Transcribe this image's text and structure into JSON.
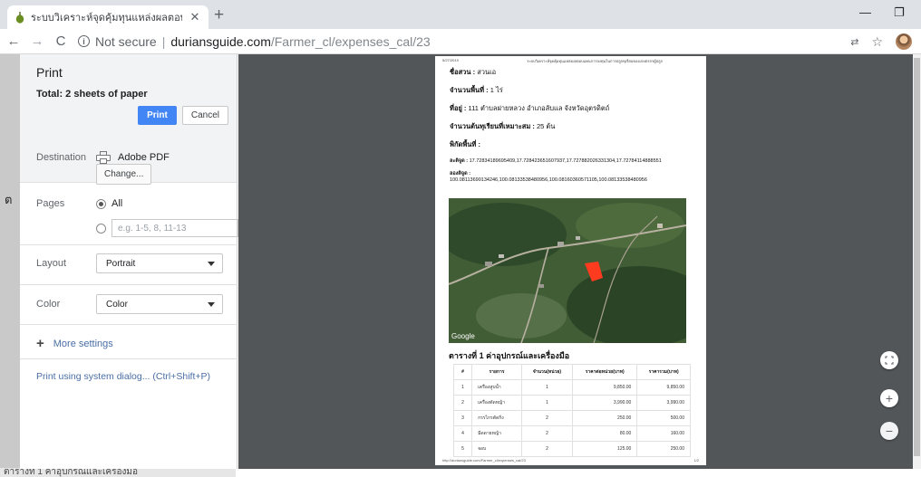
{
  "browser": {
    "tab_title": "ระบบวิเคราะห์จุดคุ้มทุนแหล่งผลตอบแทน",
    "tab_close": "✕",
    "new_tab": "+",
    "url_security": "Not secure",
    "url_host": "duriansguide.com",
    "url_path": "/Farmer_cl/expenses_cal/23"
  },
  "print_panel": {
    "title": "Print",
    "total": "Total: 2 sheets of paper",
    "print_label": "Print",
    "cancel_label": "Cancel",
    "destination_label": "Destination",
    "destination_value": "Adobe PDF",
    "change_label": "Change...",
    "pages_label": "Pages",
    "pages_all_label": "All",
    "pages_placeholder": "e.g. 1-5, 8, 11-13",
    "layout_label": "Layout",
    "layout_value": "Portrait",
    "color_label": "Color",
    "color_value": "Color",
    "more_settings": "More settings",
    "system_dialog": "Print using system dialog... (Ctrl+Shift+P)"
  },
  "preview": {
    "header_date": "5/27/2019",
    "header_title": "ระบบวิเคราะห์จุดคุ้มทุนแหล่งผลตอบแทนการลงทุนในการปลูกทุเรียนของเกษตรกรผู้ปลูก",
    "garden_name_label": "ชื่อสวน :",
    "garden_name": "สวนเอ",
    "area_label": "จำนวนพื้นที่ :",
    "area": "1 ไร่",
    "address_label": "ที่อยู่ :",
    "address": "111 ตำบลฝายหลวง อำเภอลับแล จังหวัดอุตรดิตถ์",
    "trees_label": "จำนวนต้นทุเรียนที่เหมาะสม :",
    "trees": "25 ต้น",
    "coords_label": "พิกัดพื้นที่ :",
    "lat_label": "ละติจูด :",
    "lat": "17.72834189695409,17.728423651607937,17.727882026331304,17.72784114888551",
    "lng_label": "ลองติจูด :",
    "lng": "100.08113690134246,100.08133538480956,100.08160360571105,100.08133538480956",
    "map_brand": "Google",
    "table_title": "ตารางที่ 1 ค่าอุปกรณ์และเครื่องมือ",
    "table_headers": [
      "#",
      "รายการ",
      "จำนวน(หน่วย)",
      "ราคาต่อหน่วย(บาท)",
      "ราคารวม(บาท)"
    ],
    "table_rows": [
      [
        "1",
        "เครื่องสูบน้ำ",
        "1",
        "9,850.00",
        "9,850.00"
      ],
      [
        "2",
        "เครื่องตัดหญ้า",
        "1",
        "3,990.00",
        "3,990.00"
      ],
      [
        "3",
        "กรรไกรตัดกิ่ง",
        "2",
        "250.00",
        "500.00"
      ],
      [
        "4",
        "มีดดายหญ้า",
        "2",
        "80.00",
        "160.00"
      ],
      [
        "5",
        "จอบ",
        "2",
        "125.00",
        "250.00"
      ]
    ],
    "footer_url": "http://duriansguide.com/Farmer_cl/expenses_cal/23",
    "footer_page": "1/2"
  },
  "background_page": {
    "side_glyph": "ต",
    "bottom_text": "ตารางที่ 1 ค่าอุปกรณ์และเครื่องมือ"
  }
}
